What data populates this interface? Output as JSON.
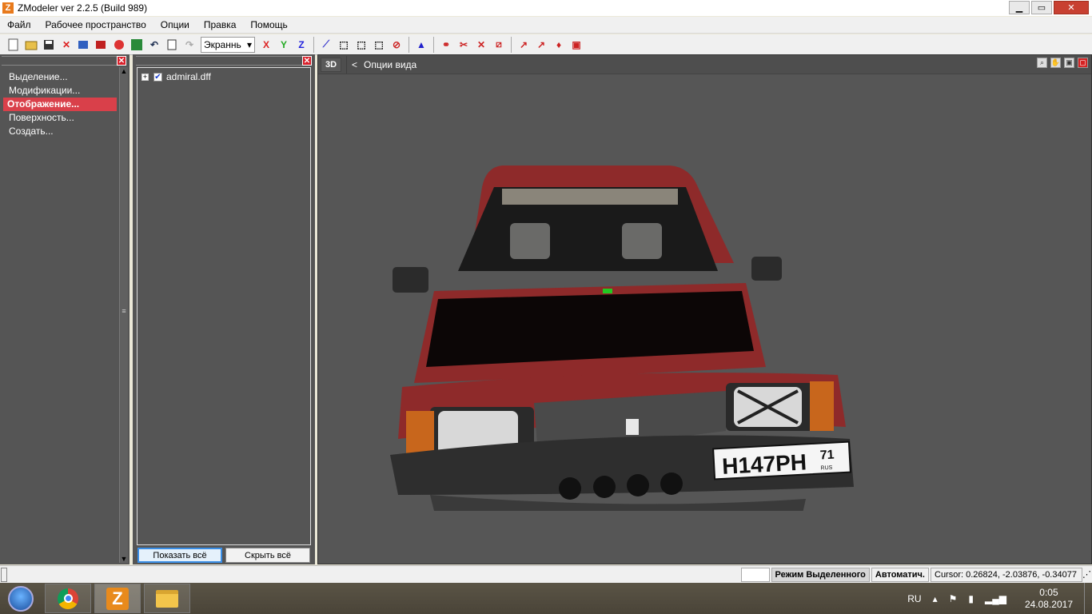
{
  "window": {
    "title": "ZModeler ver 2.2.5 (Build 989)",
    "minimize": "▁",
    "maximize": "▭",
    "close": "✕"
  },
  "menu": [
    "Файл",
    "Рабочее пространство",
    "Опции",
    "Правка",
    "Помощь"
  ],
  "toolbar": {
    "view_select": "Экраннь",
    "axis_x": "X",
    "axis_y": "Y",
    "axis_z": "Z"
  },
  "left_panel": {
    "items": [
      {
        "label": "Выделение...",
        "active": false
      },
      {
        "label": "Модификации...",
        "active": false
      },
      {
        "label": "Отображение...",
        "active": true
      },
      {
        "label": "Поверхность...",
        "active": false
      },
      {
        "label": "Создать...",
        "active": false
      }
    ]
  },
  "tree_panel": {
    "node": {
      "label": "admiral.dff",
      "checked": true
    },
    "show_all": "Показать всё",
    "hide_all": "Скрыть всё"
  },
  "viewport": {
    "mode": "3D",
    "back": "<",
    "options_label": "Опции вида"
  },
  "car": {
    "plate_text": "Н147РН",
    "plate_region": "71",
    "plate_country": "RUS",
    "body_color": "#8e2a2a"
  },
  "statusbar": {
    "mode": "Режим Выделенного",
    "auto": "Автоматич.",
    "cursor": "Cursor: 0.26824, -2.03876, -0.34077"
  },
  "taskbar": {
    "lang": "RU",
    "time": "0:05",
    "date": "24.08.2017"
  }
}
